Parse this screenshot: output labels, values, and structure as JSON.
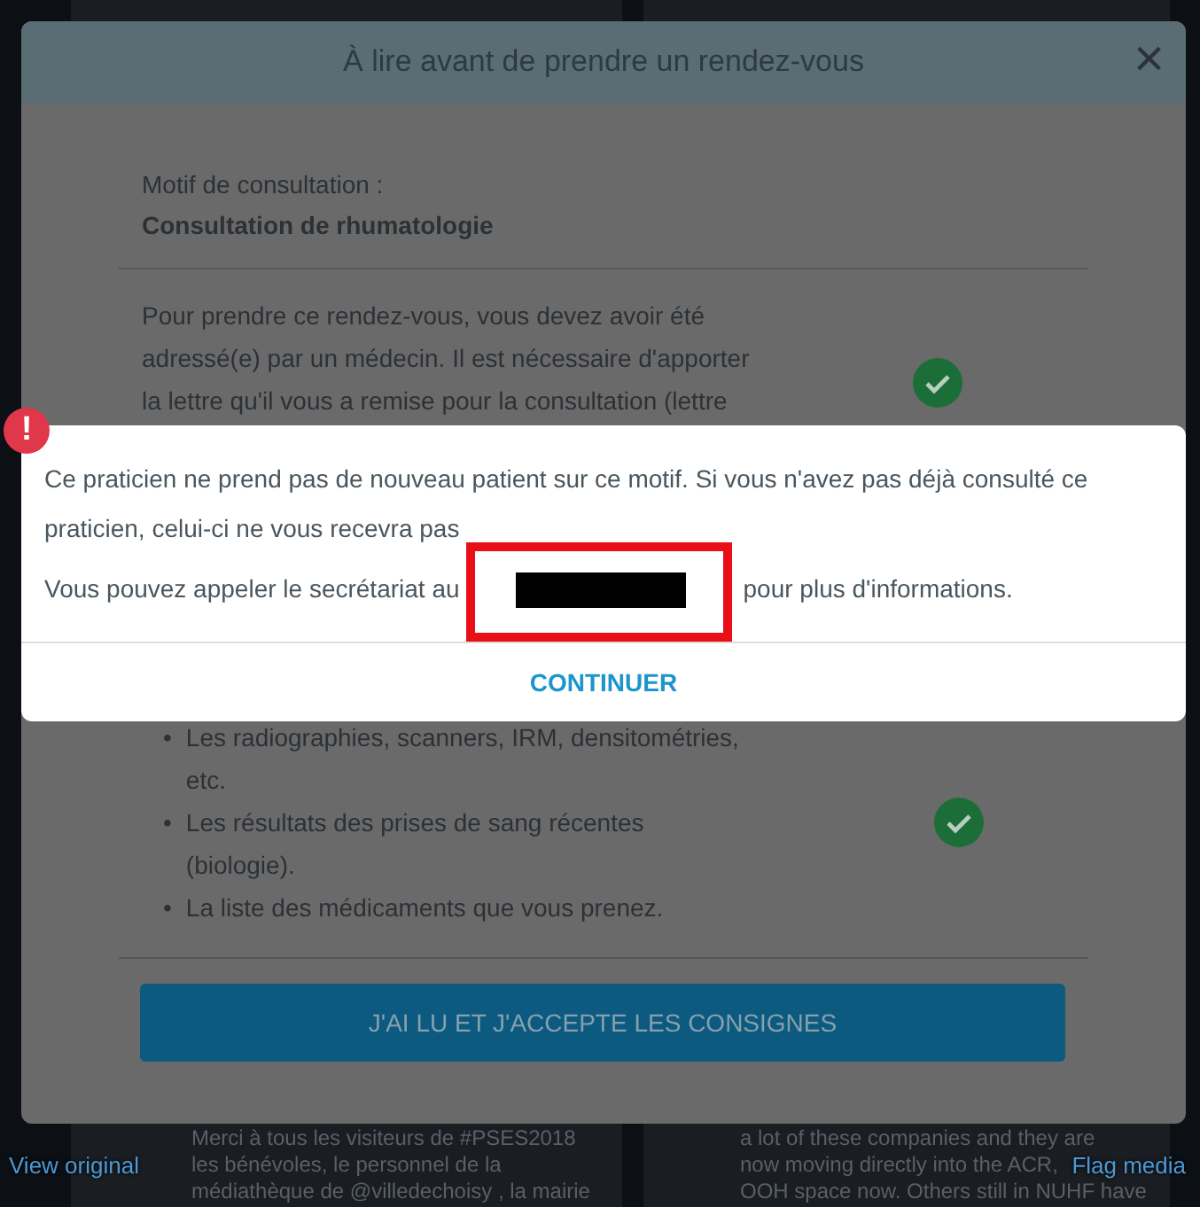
{
  "background": {
    "posts": [
      {
        "lines": [
          "Merci à tous les visiteurs de #PSES2018",
          "les bénévoles, le personnel de la",
          "médiathèque de @villedechoisy , la mairie"
        ]
      },
      {
        "lines": [
          "a lot of these companies and they are",
          "now moving directly into the ACR,",
          "OOH space now. Others still in NUHF have"
        ]
      }
    ],
    "links": [
      "View original",
      "Flag media"
    ]
  },
  "modal": {
    "title": "À lire avant de prendre un rendez-vous",
    "close": "×",
    "motif_label": "Motif de consultation :",
    "motif_value": "Consultation de rhumatologie",
    "sections": [
      {
        "kind": "paragraph",
        "text": "Pour prendre ce rendez-vous, vous devez avoir été adressé(e) par un médecin. Il est nécessaire d'apporter la lettre qu'il vous a remise pour la consultation (lettre",
        "checked": true
      },
      {
        "kind": "list",
        "bullet": "•",
        "items": [
          "Les radiographies, scanners, IRM, densitométries, etc.",
          "Les résultats des prises de sang récentes (biologie).",
          "La liste des médicaments que vous prenez."
        ],
        "checked": true
      }
    ],
    "accept_button": "J'AI LU ET J'ACCEPTE LES CONSIGNES"
  },
  "alert": {
    "icon": "!",
    "message": "Ce praticien ne prend pas de nouveau patient sur ce motif. Si vous n'avez pas déjà consulté ce praticien, celui-ci ne vous recevra pas",
    "call_before": "Vous pouvez appeler le secrétariat au",
    "call_after": "pour plus d'informations.",
    "redacted": true,
    "button": "CONTINUER"
  }
}
